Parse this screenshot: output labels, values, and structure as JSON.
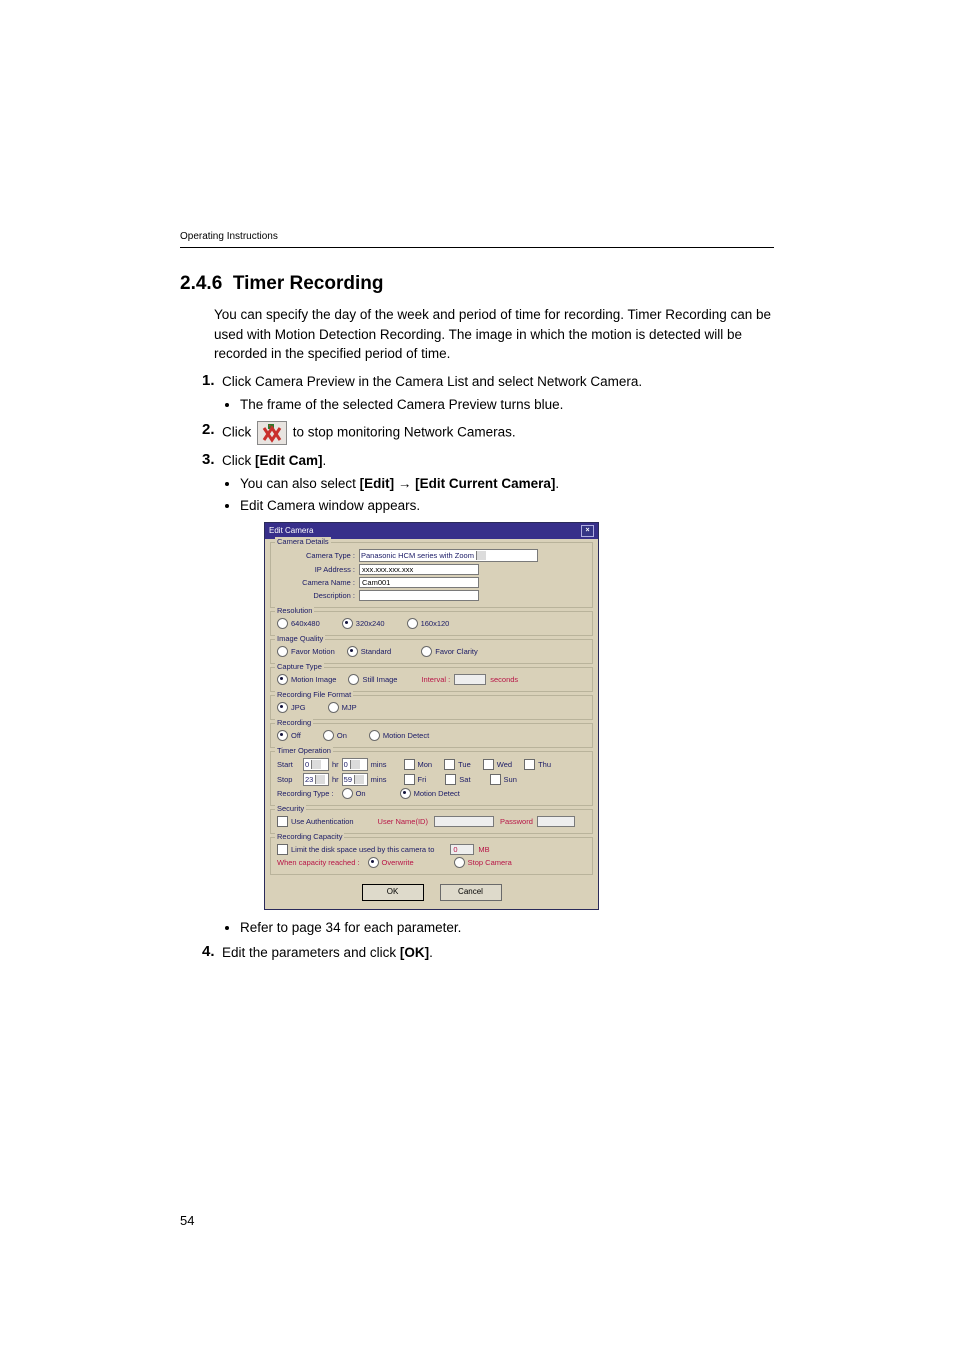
{
  "running_head": "Operating Instructions",
  "section": {
    "number": "2.4.6",
    "title": "Timer Recording"
  },
  "intro": "You can specify the day of the week and period of time for recording. Timer Recording can be used with Motion Detection Recording. The image in which the motion is detected will be recorded in the specified period of time.",
  "steps": {
    "s1": {
      "num": "1.",
      "text": "Click Camera Preview in the Camera List and select Network Camera.",
      "sub1": "The frame of the selected Camera Preview turns blue."
    },
    "s2": {
      "num": "2.",
      "text_before": "Click ",
      "text_after": " to stop monitoring Network Cameras.",
      "icon_name": "stop-monitoring-icon"
    },
    "s3": {
      "num": "3.",
      "text_before": "Click ",
      "bold": "[Edit Cam]",
      "text_after": ".",
      "sub1_before": "You can also select ",
      "sub1_bold1": "[Edit]",
      "sub1_arrow": " → ",
      "sub1_bold2": "[Edit Current Camera]",
      "sub1_after": ".",
      "sub2": "Edit Camera window appears.",
      "sub3": "Refer to page 34 for each parameter."
    },
    "s4": {
      "num": "4.",
      "text_before": "Edit the parameters and click ",
      "bold": "[OK]",
      "text_after": "."
    }
  },
  "dialog": {
    "title": "Edit Camera",
    "close": "×",
    "camera_details": {
      "legend": "Camera Details",
      "type_label": "Camera Type :",
      "type_value": "Panasonic HCM series with Zoom",
      "ip_label": "IP Address :",
      "ip_value": "xxx.xxx.xxx.xxx",
      "name_label": "Camera Name :",
      "name_value": "Cam001",
      "desc_label": "Description :",
      "desc_value": ""
    },
    "resolution": {
      "legend": "Resolution",
      "r1": "640x480",
      "r2": "320x240",
      "r3": "160x120",
      "selected": "r2"
    },
    "image_quality": {
      "legend": "Image Quality",
      "q1": "Favor Motion",
      "q2": "Standard",
      "q3": "Favor Clarity",
      "selected": "q2"
    },
    "capture_type": {
      "legend": "Capture Type",
      "c1": "Motion Image",
      "c2": "Still Image",
      "interval_label": "Interval :",
      "interval_value": "",
      "interval_unit": "seconds",
      "selected": "c1"
    },
    "file_format": {
      "legend": "Recording File Format",
      "f1": "JPG",
      "f2": "MJP",
      "selected": "f1"
    },
    "recording": {
      "legend": "Recording",
      "r1": "Off",
      "r2": "On",
      "r3": "Motion Detect",
      "selected": "r1"
    },
    "timer": {
      "legend": "Timer Operation",
      "start_label": "Start",
      "start_hr": "0",
      "hr_unit": "hr",
      "start_min": "0",
      "min_unit": "mins",
      "stop_label": "Stop",
      "stop_hr": "23",
      "stop_min": "59",
      "days": {
        "mon": "Mon",
        "tue": "Tue",
        "wed": "Wed",
        "thu": "Thu",
        "fri": "Fri",
        "sat": "Sat",
        "sun": "Sun"
      },
      "rectype_label": "Recording Type :",
      "rt1": "On",
      "rt2": "Motion Detect",
      "rt_selected": "rt2"
    },
    "security": {
      "legend": "Security",
      "use_auth": "Use Authentication",
      "user_label": "User Name(ID)",
      "user_value": "",
      "pass_label": "Password",
      "pass_value": ""
    },
    "capacity": {
      "legend": "Recording Capacity",
      "limit_label_before": "Limit the disk space used by this camera to",
      "limit_value": "0",
      "limit_unit": "MB",
      "reached_label": "When capacity reached :",
      "opt1": "Overwrite",
      "opt2": "Stop Camera",
      "selected": "opt1"
    },
    "buttons": {
      "ok": "OK",
      "cancel": "Cancel"
    }
  },
  "page_number": "54"
}
